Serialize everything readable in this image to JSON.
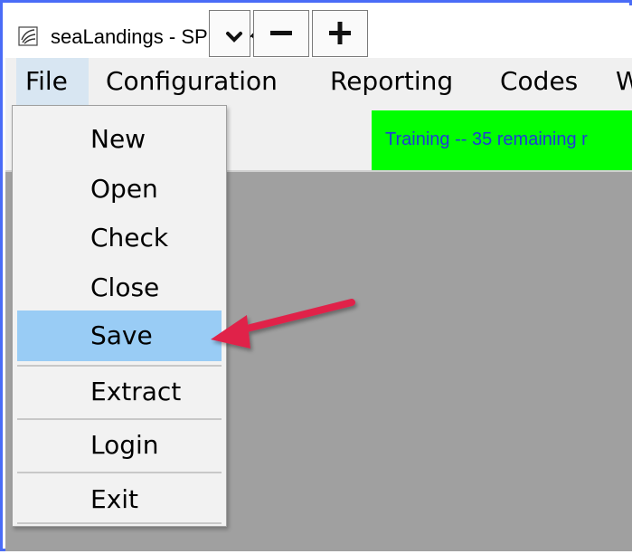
{
  "window": {
    "title": "seaLandings - SPLANKTON",
    "app_icon": "sealandings-app-icon"
  },
  "menubar": {
    "items": [
      {
        "label": "File"
      },
      {
        "label": "Configuration"
      },
      {
        "label": "Reporting"
      },
      {
        "label": "Codes"
      },
      {
        "label": "W"
      }
    ]
  },
  "toolbar": {
    "buttons": [
      {
        "icon": "chevron-down-icon"
      },
      {
        "icon": "minus-icon"
      },
      {
        "icon": "plus-icon"
      }
    ],
    "status_text": "Training -- 35 remaining r",
    "status_color": "#00ff00"
  },
  "file_menu": {
    "items": [
      {
        "label": "New"
      },
      {
        "label": "Open"
      },
      {
        "label": "Check"
      },
      {
        "label": "Close"
      },
      {
        "label": "Save",
        "selected": true
      },
      {
        "label": "Extract"
      },
      {
        "label": "Login"
      },
      {
        "label": "Exit"
      }
    ],
    "highlight_color": "#99ccf5"
  },
  "annotation": {
    "icon": "red-arrow-pointer-icon",
    "color": "#e0204a"
  }
}
